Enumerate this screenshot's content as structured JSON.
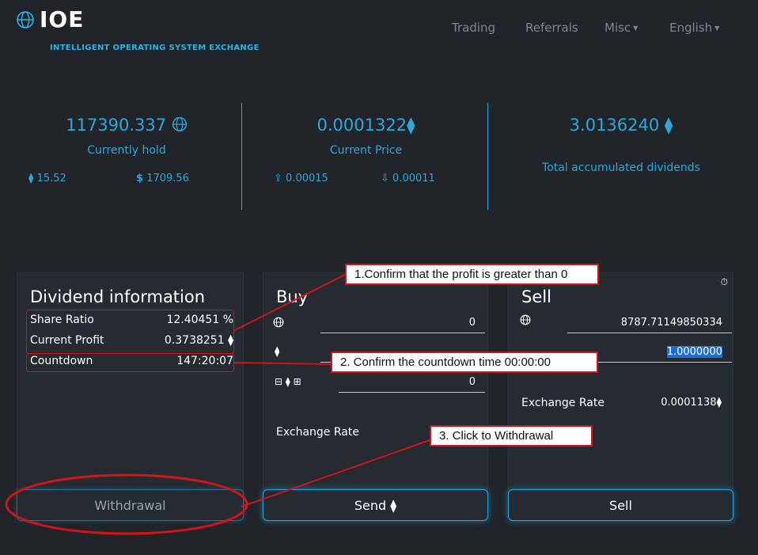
{
  "brand": {
    "title": "IOE",
    "subtitle": "INTELLIGENT OPERATING SYSTEM EXCHANGE"
  },
  "nav": {
    "trading": "Trading",
    "referrals": "Referrals",
    "misc": "Misc",
    "language": "English"
  },
  "stats": {
    "hold": {
      "value": "117390.337",
      "label": "Currently hold",
      "eth": "15.52",
      "usd": "1709.56"
    },
    "price": {
      "value": "0.0001322",
      "label": "Current Price",
      "up": "0.00015",
      "down": "0.00011"
    },
    "dividends": {
      "value": "3.0136240",
      "label": "Total accumulated dividends"
    }
  },
  "dividend": {
    "title": "Dividend information",
    "share_ratio_label": "Share Ratio",
    "share_ratio_value": "12.40451 %",
    "profit_label": "Current Profit",
    "profit_value": "0.3738251",
    "countdown_label": "Countdown",
    "countdown_value": "147:20:07",
    "button": "Withdrawal"
  },
  "buy": {
    "title": "Buy",
    "token_amount": "0",
    "eth_amount": "",
    "adjust_amount": "0",
    "rate_label": "Exchange Rate",
    "button": "Send"
  },
  "sell": {
    "title": "Sell",
    "token_amount": "8787.71149850334",
    "eth_amount": "1.0000000",
    "rate_label": "Exchange Rate",
    "rate_value": "0.0001138",
    "button": "Sell"
  },
  "annotations": {
    "step1": "1.Confirm that the profit is greater than 0",
    "step2": "2. Confirm the countdown time 00:00:00",
    "step3": "3. Click to Withdrawal"
  },
  "colors": {
    "accent": "#2ba8dc",
    "annotation": "#d0141a",
    "background": "#21252a"
  }
}
